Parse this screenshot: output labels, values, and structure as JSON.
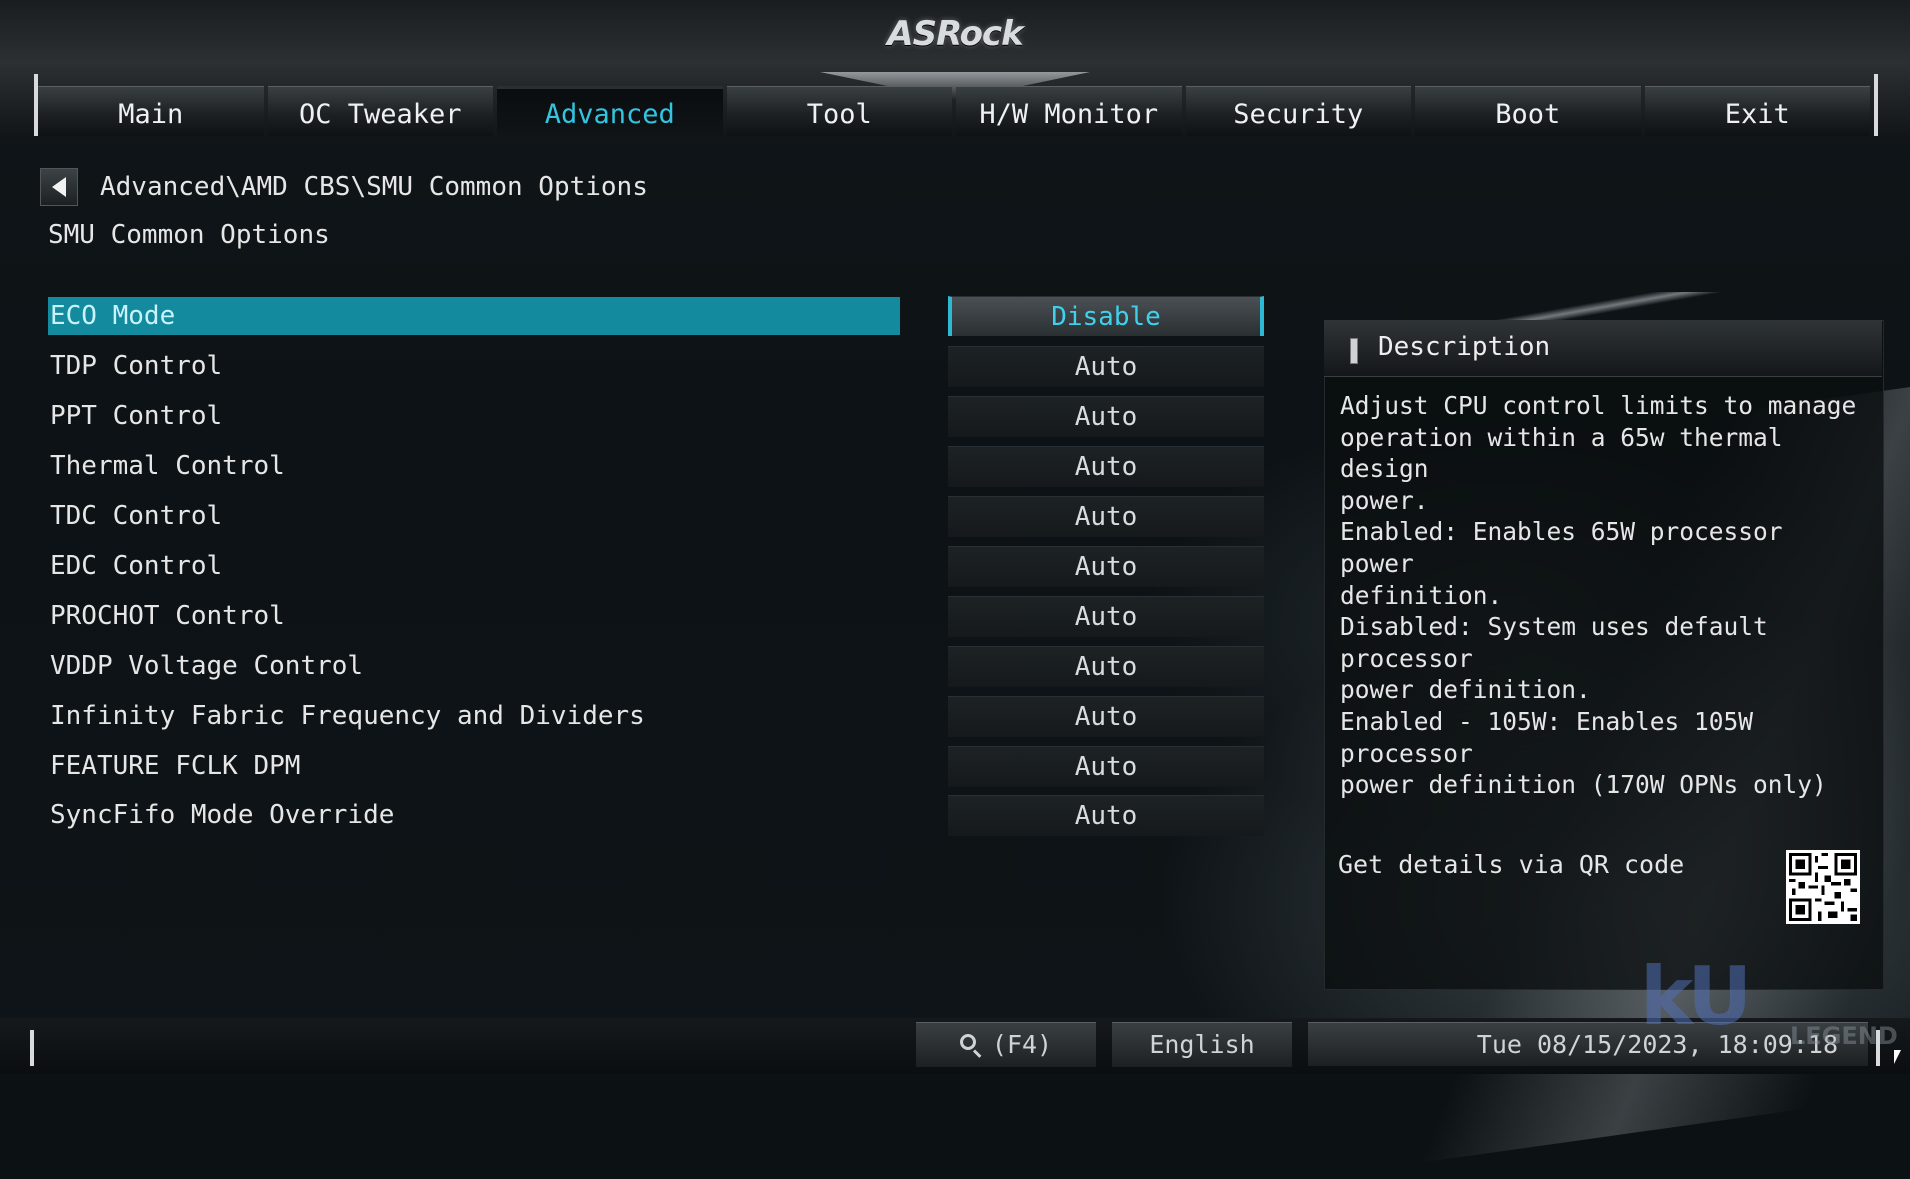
{
  "brand": {
    "logo": "ASRock"
  },
  "tabs": [
    {
      "label": "Main",
      "active": false
    },
    {
      "label": "OC Tweaker",
      "active": false
    },
    {
      "label": "Advanced",
      "active": true
    },
    {
      "label": "Tool",
      "active": false
    },
    {
      "label": "H/W Monitor",
      "active": false
    },
    {
      "label": "Security",
      "active": false
    },
    {
      "label": "Boot",
      "active": false
    },
    {
      "label": "Exit",
      "active": false
    }
  ],
  "breadcrumb": "Advanced\\AMD CBS\\SMU Common Options",
  "page_title": "SMU Common Options",
  "options": [
    {
      "label": "ECO Mode",
      "value": "Disable",
      "selected": true
    },
    {
      "label": "TDP Control",
      "value": "Auto"
    },
    {
      "label": "PPT Control",
      "value": "Auto"
    },
    {
      "label": "Thermal Control",
      "value": "Auto"
    },
    {
      "label": "TDC Control",
      "value": "Auto"
    },
    {
      "label": "EDC Control",
      "value": "Auto"
    },
    {
      "label": "PROCHOT Control",
      "value": "Auto"
    },
    {
      "label": "VDDP Voltage Control",
      "value": "Auto"
    },
    {
      "label": "Infinity Fabric Frequency and Dividers",
      "value": "Auto"
    },
    {
      "label": "FEATURE FCLK DPM",
      "value": "Auto"
    },
    {
      "label": "SyncFifo Mode Override",
      "value": "Auto"
    }
  ],
  "description": {
    "title": "Description",
    "text": "Adjust CPU control limits to manage\noperation within a 65w thermal design\npower.\nEnabled: Enables 65W processor power\ndefinition.\nDisabled: System uses default processor\npower definition.\nEnabled - 105W: Enables 105W processor\npower definition (170W OPNs only)",
    "qr_label": "Get details via QR code"
  },
  "footer": {
    "search_label": "(F4)",
    "language": "English",
    "datetime": "Tue 08/15/2023, 18:09:18"
  },
  "watermark": {
    "main": "kU",
    "sub": "LEGEND"
  },
  "colors": {
    "accent": "#33c5e0",
    "selected_row": "#138a9e"
  }
}
